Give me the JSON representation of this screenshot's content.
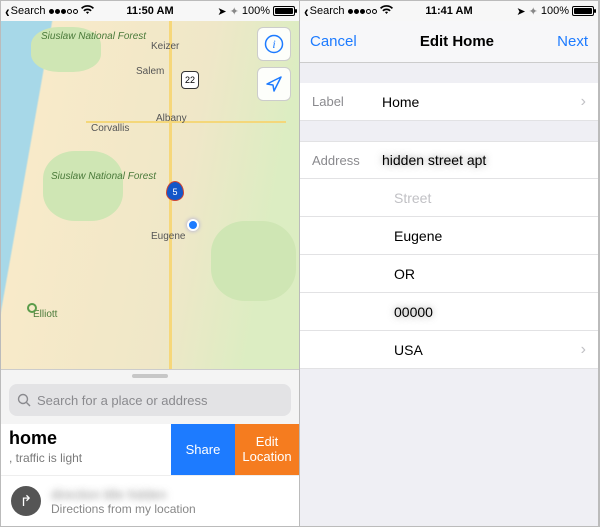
{
  "statusbar": {
    "back_label": "Search",
    "time_left": "11:50 AM",
    "time_right": "11:41 AM",
    "battery_pct": "100%"
  },
  "map": {
    "cities": {
      "keizer": "Keizer",
      "salem": "Salem",
      "albany": "Albany",
      "corvallis": "Corvallis",
      "eugene": "Eugene",
      "elliott": "Elliott"
    },
    "forests": {
      "siuslaw1": "Siuslaw National Forest",
      "siuslaw2": "Siuslaw National Forest"
    },
    "highways": {
      "r22": "22",
      "i5": "5"
    },
    "search_placeholder": "Search for a place or address",
    "card": {
      "title_partial": "home",
      "subtitle_partial": ", traffic is light",
      "share": "Share",
      "edit": "Edit Location"
    },
    "directions": {
      "line1_blurred": "direction title hidden",
      "line2": "Directions from my location"
    }
  },
  "edit": {
    "cancel": "Cancel",
    "title": "Edit Home",
    "next": "Next",
    "label_key": "Label",
    "label_val": "Home",
    "address_key": "Address",
    "street_placeholder": "Street",
    "city": "Eugene",
    "state": "OR",
    "zip_blurred": "00000",
    "country": "USA"
  }
}
